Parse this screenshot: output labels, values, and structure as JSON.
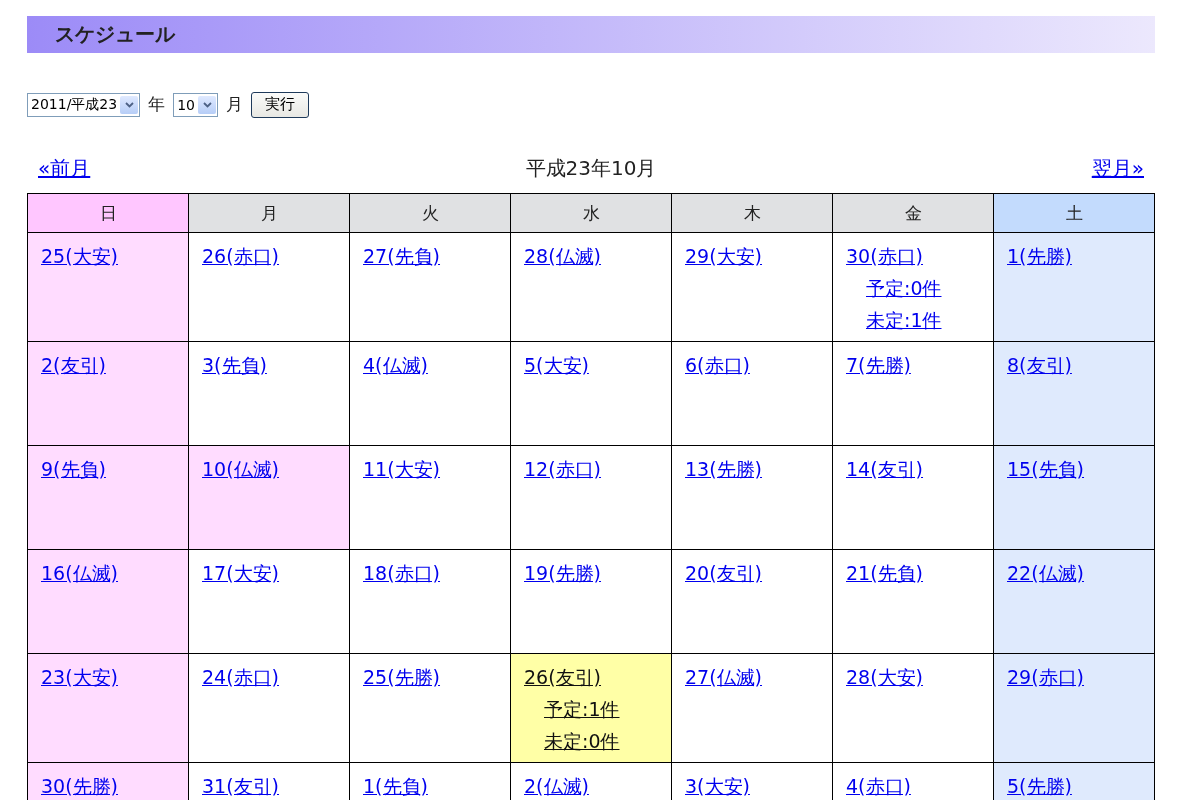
{
  "page_title": "スケジュール",
  "controls": {
    "year": "2011/平成23",
    "year_label": "年",
    "month": "10",
    "month_label": "月",
    "submit": "実行"
  },
  "nav": {
    "prev": "«前月",
    "current": "平成23年10月",
    "next": "翌月»"
  },
  "weekdays": [
    {
      "label": "日",
      "kind": "sunday"
    },
    {
      "label": "月",
      "kind": "weekday"
    },
    {
      "label": "火",
      "kind": "weekday"
    },
    {
      "label": "水",
      "kind": "weekday"
    },
    {
      "label": "木",
      "kind": "weekday"
    },
    {
      "label": "金",
      "kind": "weekday"
    },
    {
      "label": "土",
      "kind": "saturday"
    }
  ],
  "weeks": [
    {
      "days": [
        {
          "label": "25(大安)",
          "today": false
        },
        {
          "label": "26(赤口)",
          "holiday": false,
          "today": false
        },
        {
          "label": "27(先負)",
          "holiday": false,
          "today": false
        },
        {
          "label": "28(仏滅)",
          "holiday": false,
          "today": false
        },
        {
          "label": "29(大安)",
          "holiday": false,
          "today": false
        },
        {
          "label": "30(赤口)",
          "holiday": false,
          "today": false,
          "events": [
            "予定:0件",
            "未定:1件"
          ]
        },
        {
          "label": "1(先勝)",
          "holiday": false,
          "today": false
        }
      ]
    },
    {
      "days": [
        {
          "label": "2(友引)",
          "today": false
        },
        {
          "label": "3(先負)",
          "holiday": false,
          "today": false
        },
        {
          "label": "4(仏滅)",
          "holiday": false,
          "today": false
        },
        {
          "label": "5(大安)",
          "holiday": false,
          "today": false
        },
        {
          "label": "6(赤口)",
          "holiday": false,
          "today": false
        },
        {
          "label": "7(先勝)",
          "holiday": false,
          "today": false
        },
        {
          "label": "8(友引)",
          "holiday": false,
          "today": false
        }
      ]
    },
    {
      "days": [
        {
          "label": "9(先負)",
          "today": false
        },
        {
          "label": "10(仏滅)",
          "holiday": true,
          "today": false
        },
        {
          "label": "11(大安)",
          "holiday": false,
          "today": false
        },
        {
          "label": "12(赤口)",
          "holiday": false,
          "today": false
        },
        {
          "label": "13(先勝)",
          "holiday": false,
          "today": false
        },
        {
          "label": "14(友引)",
          "holiday": false,
          "today": false
        },
        {
          "label": "15(先負)",
          "holiday": false,
          "today": false
        }
      ]
    },
    {
      "days": [
        {
          "label": "16(仏滅)",
          "today": false
        },
        {
          "label": "17(大安)",
          "holiday": false,
          "today": false
        },
        {
          "label": "18(赤口)",
          "holiday": false,
          "today": false
        },
        {
          "label": "19(先勝)",
          "holiday": false,
          "today": false
        },
        {
          "label": "20(友引)",
          "holiday": false,
          "today": false
        },
        {
          "label": "21(先負)",
          "holiday": false,
          "today": false
        },
        {
          "label": "22(仏滅)",
          "holiday": false,
          "today": false
        }
      ]
    },
    {
      "days": [
        {
          "label": "23(大安)",
          "today": false
        },
        {
          "label": "24(赤口)",
          "holiday": false,
          "today": false
        },
        {
          "label": "25(先勝)",
          "holiday": false,
          "today": false
        },
        {
          "label": "26(友引)",
          "holiday": false,
          "today": true,
          "events": [
            "予定:1件",
            "未定:0件"
          ]
        },
        {
          "label": "27(仏滅)",
          "holiday": false,
          "today": false
        },
        {
          "label": "28(大安)",
          "holiday": false,
          "today": false
        },
        {
          "label": "29(赤口)",
          "holiday": false,
          "today": false
        }
      ]
    },
    {
      "days": [
        {
          "label": "30(先勝)",
          "today": false
        },
        {
          "label": "31(友引)",
          "holiday": false,
          "today": false
        },
        {
          "label": "1(先負)",
          "holiday": false,
          "today": false
        },
        {
          "label": "2(仏滅)",
          "holiday": false,
          "today": false
        },
        {
          "label": "3(大安)",
          "holiday": false,
          "today": false
        },
        {
          "label": "4(赤口)",
          "holiday": false,
          "today": false
        },
        {
          "label": "5(先勝)",
          "holiday": false,
          "today": false
        }
      ]
    }
  ]
}
